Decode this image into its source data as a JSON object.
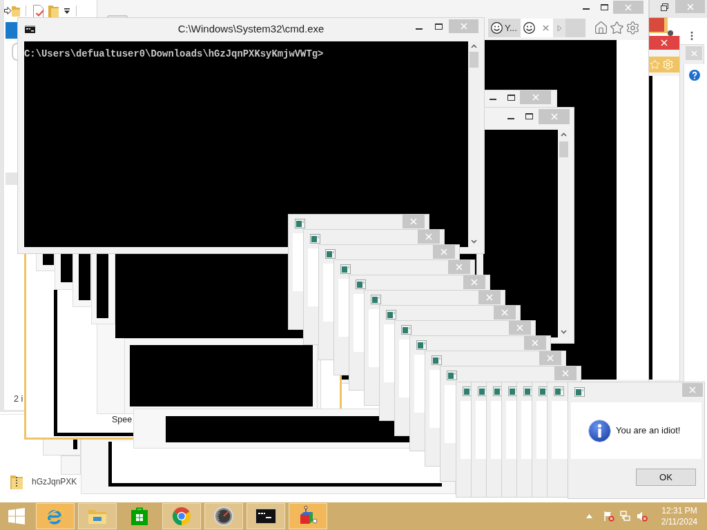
{
  "explorer": {
    "status_text": "2 i"
  },
  "browser": {
    "tabs": [
      {
        "label": "Y...",
        "selected": false
      },
      {
        "selected": true
      }
    ]
  },
  "cmd": {
    "title": "C:\\Windows\\System32\\cmd.exe",
    "prompt": "C:\\Users\\defualtuser0\\Downloads\\hGzJqnPXKsyKmjwVWTg>"
  },
  "speed_window": {
    "label": "Spee"
  },
  "downloads": {
    "file_name": "hGzJqnPXK"
  },
  "message_box": {
    "message": "You are an idiot!",
    "button": "OK"
  },
  "taskbar": {
    "apps": [
      {
        "kind": "ie",
        "running": true,
        "flashing": true
      },
      {
        "kind": "explorer",
        "running": true,
        "flashing": false
      },
      {
        "kind": "store",
        "running": false,
        "flashing": false
      },
      {
        "kind": "chrome",
        "running": true,
        "flashing": false
      },
      {
        "kind": "gauge",
        "running": true,
        "flashing": false
      },
      {
        "kind": "console",
        "running": true,
        "flashing": false
      },
      {
        "kind": "cube",
        "running": true,
        "flashing": true
      }
    ],
    "clock": {
      "time": "12:31 PM",
      "date": "2/11/2024"
    }
  }
}
